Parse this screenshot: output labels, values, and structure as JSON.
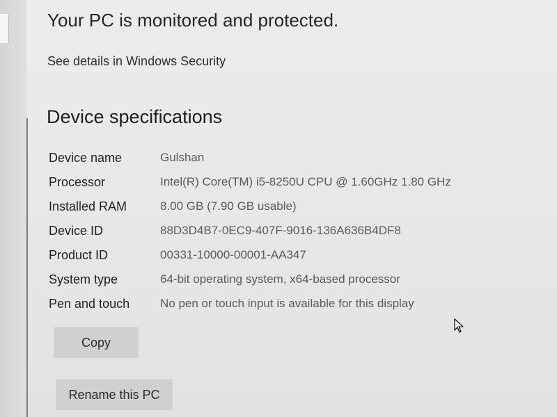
{
  "security": {
    "title": "Your PC is monitored and protected.",
    "link": "See details in Windows Security"
  },
  "device_specifications": {
    "title": "Device specifications",
    "rows": [
      {
        "label": "Device name",
        "value": "Gulshan"
      },
      {
        "label": "Processor",
        "value": "Intel(R) Core(TM) i5-8250U CPU @ 1.60GHz   1.80 GHz"
      },
      {
        "label": "Installed RAM",
        "value": "8.00 GB (7.90 GB usable)"
      },
      {
        "label": "Device ID",
        "value": "88D3D4B7-0EC9-407F-9016-136A636B4DF8"
      },
      {
        "label": "Product ID",
        "value": "00331-10000-00001-AA347"
      },
      {
        "label": "System type",
        "value": "64-bit operating system, x64-based processor"
      },
      {
        "label": "Pen and touch",
        "value": "No pen or touch input is available for this display"
      }
    ]
  },
  "buttons": {
    "copy": "Copy",
    "rename": "Rename this PC"
  },
  "icons": {
    "cursor": "mouse-pointer-icon"
  }
}
